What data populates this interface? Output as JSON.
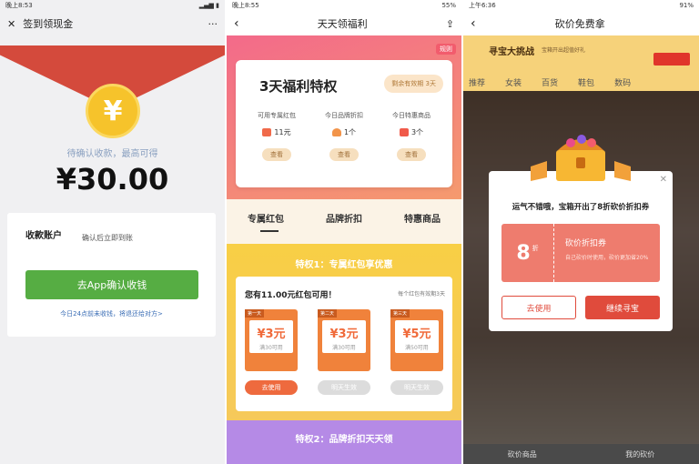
{
  "panel1": {
    "status_time": "晚上8:53",
    "title": "签到领现金",
    "more": "···",
    "hint": "待确认收款，最高可得",
    "amount": "¥30.00",
    "account_label": "收款账户",
    "account_value": "确认后立即到账",
    "confirm_button": "去App确认收钱",
    "note": "今日24点前未收钱，将退还给对方>"
  },
  "panel2": {
    "status_time": "晚上8:55",
    "status_right": "55%",
    "title": "天天领福利",
    "hero_badge": "规则",
    "card_title": "3天福利特权",
    "timer": "剩余有效期 3天",
    "columns": [
      {
        "label": "可用专属红包",
        "value": "11元",
        "btn": "查看"
      },
      {
        "label": "今日品牌折扣",
        "value": "1个",
        "btn": "查看"
      },
      {
        "label": "今日特惠商品",
        "value": "3个",
        "btn": "查看"
      }
    ],
    "tabs": [
      "专属红包",
      "品牌折扣",
      "特惠商品"
    ],
    "privilege1": "特权1：专属红包享优惠",
    "redpacket_head": "您有11.00元红包可用！",
    "redpacket_note": "每个红包有效期3天",
    "coupons": [
      {
        "tag": "第一天",
        "amount": "¥3元",
        "threshold": "满30可用",
        "action": "去使用"
      },
      {
        "tag": "第二天",
        "amount": "¥3元",
        "threshold": "满30可用",
        "action": "明天生效"
      },
      {
        "tag": "第三天",
        "amount": "¥5元",
        "threshold": "满50可用",
        "action": "明天生效"
      }
    ],
    "privilege2": "特权2：品牌折扣天天领"
  },
  "panel3": {
    "status_time": "上午6:36",
    "status_right": "91%",
    "title": "砍价免费拿",
    "banner_title": "寻宝大挑战",
    "banner_sub": "宝箱开出超值好礼",
    "cat_tabs": [
      "推荐",
      "女装",
      "百货",
      "鞋包",
      "数码"
    ],
    "modal_title": "运气不错哦，宝箱开出了8折砍价折扣券",
    "voucher_num": "8",
    "voucher_unit": "折",
    "voucher_name": "砍价折扣券",
    "voucher_desc": "自己砍价时使用，砍价更加省20%",
    "btn_use": "去使用",
    "btn_continue": "继续寻宝",
    "bottom_items": [
      "砍价商品",
      "我的砍价"
    ]
  }
}
